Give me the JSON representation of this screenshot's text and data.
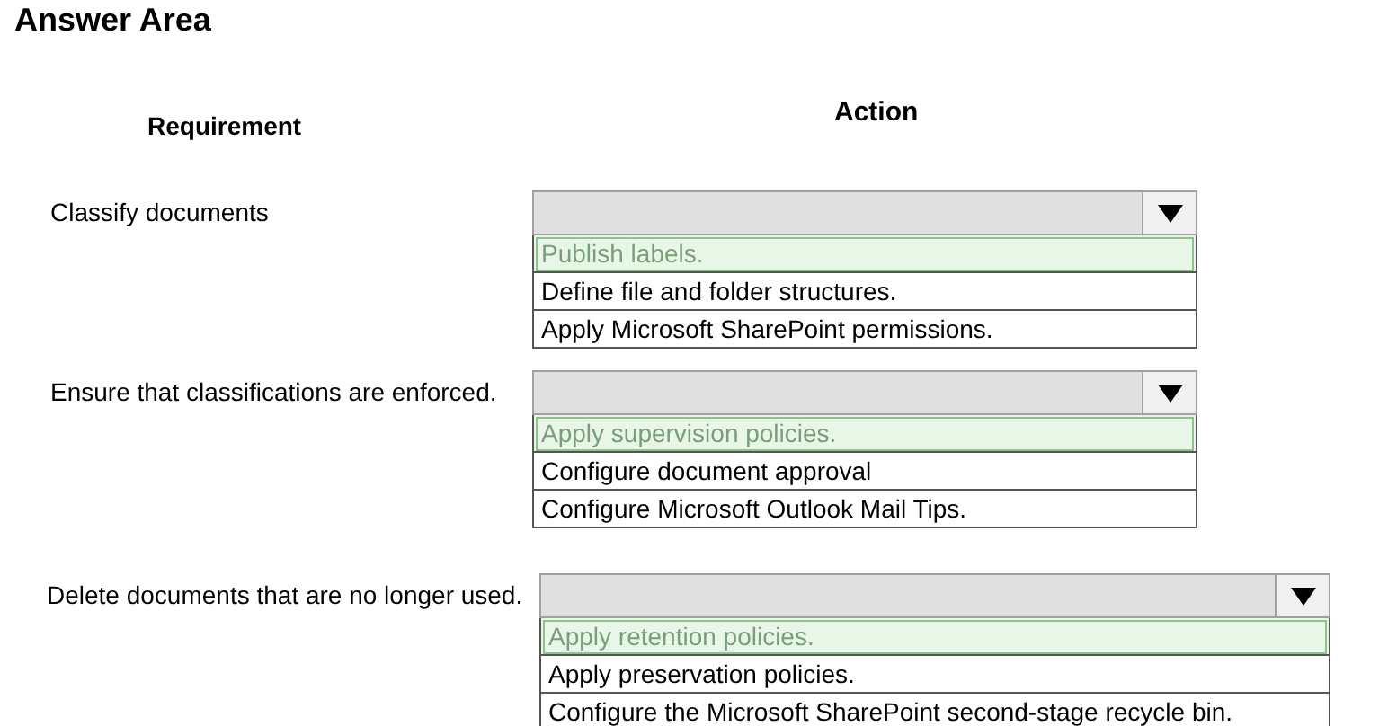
{
  "title": "Answer Area",
  "headers": {
    "requirement": "Requirement",
    "action": "Action"
  },
  "rows": [
    {
      "requirement": "Classify documents",
      "options": [
        {
          "label": "Publish labels.",
          "selected": true
        },
        {
          "label": "Define file and folder structures.",
          "selected": false
        },
        {
          "label": "Apply Microsoft SharePoint permissions.",
          "selected": false
        }
      ]
    },
    {
      "requirement": "Ensure that classifications are enforced.",
      "options": [
        {
          "label": "Apply supervision policies.",
          "selected": true
        },
        {
          "label": "Configure document approval",
          "selected": false
        },
        {
          "label": "Configure Microsoft Outlook Mail Tips.",
          "selected": false
        }
      ]
    },
    {
      "requirement": "Delete documents that are no longer used.",
      "options": [
        {
          "label": "Apply retention policies.",
          "selected": true
        },
        {
          "label": "Apply preservation policies.",
          "selected": false
        },
        {
          "label": "Configure the Microsoft SharePoint second-stage recycle bin.",
          "selected": false
        }
      ]
    }
  ]
}
